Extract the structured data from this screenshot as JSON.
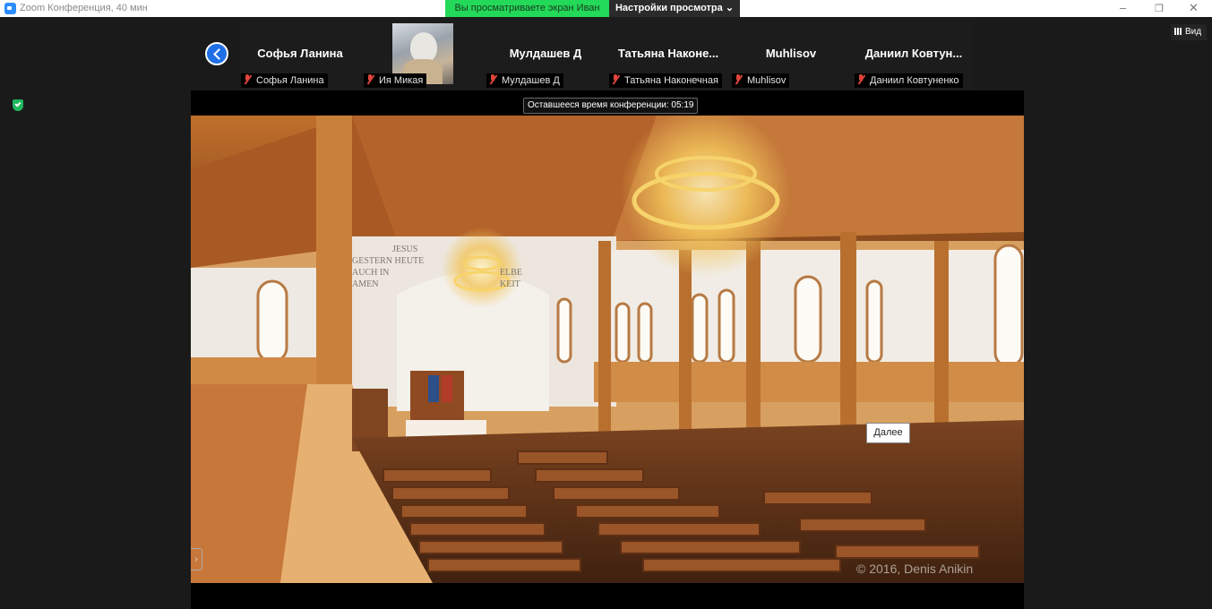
{
  "window": {
    "title": "Zoom Конференция, 40 мин",
    "controls": [
      "–",
      "❐",
      "✕"
    ]
  },
  "share_banner": {
    "viewing_text": "Вы просматриваете экран Иван",
    "view_options_label": "Настройки просмотра ⌄"
  },
  "view_button": {
    "label": "Вид"
  },
  "participants": [
    {
      "display_name": "Софья Ланина",
      "label": "Софья Ланина",
      "has_video": false
    },
    {
      "display_name": "",
      "label": "Ия Микая",
      "has_video": true
    },
    {
      "display_name": "Мулдашев Д",
      "label": "Мулдашев Д",
      "has_video": false
    },
    {
      "display_name": "Татьяна Наконе...",
      "label": "Татьяна Наконечная",
      "has_video": false
    },
    {
      "display_name": "Muhlisov",
      "label": "Muhlisov",
      "has_video": false
    },
    {
      "display_name": "Даниил Ковтун...",
      "label": "Даниил Ковтуненко",
      "has_video": false
    }
  ],
  "timer": {
    "text": "Оставшееся время конференции: 05:19"
  },
  "shared_content": {
    "wall_text": [
      "JESUS",
      "GESTERN HEUTE",
      "AUCH IN",
      "AMEN"
    ],
    "wall_text_right": [
      "ELBE",
      "KEIT"
    ],
    "copyright": "© 2016, Denis Anikin"
  },
  "tooltip": {
    "next": "Далее"
  },
  "side_toggle": {
    "glyph": "›"
  },
  "colors": {
    "green_banner": "#23d959",
    "accent_blue": "#1e6fe6",
    "muted_red": "#e0453a"
  }
}
